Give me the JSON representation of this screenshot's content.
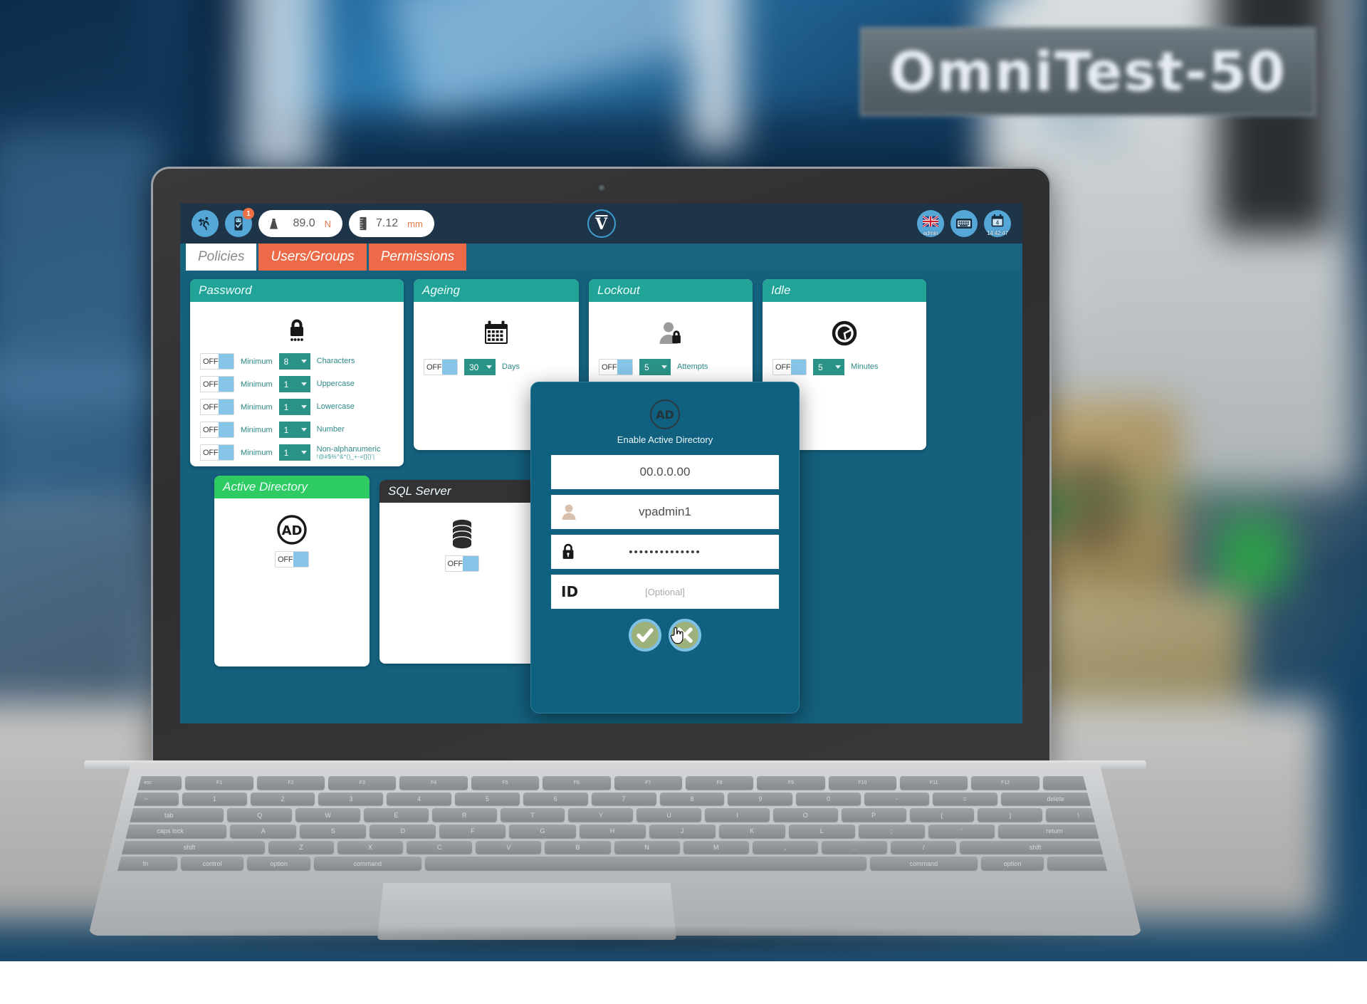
{
  "background": {
    "sign_text": "OmniTest-50"
  },
  "statusbar": {
    "left_buttons": [
      {
        "name": "emergency-stop-icon",
        "label": ""
      },
      {
        "name": "usb-device-icon",
        "label": "",
        "badge": "1"
      }
    ],
    "readouts": [
      {
        "icon": "weight-icon",
        "value": "89.0",
        "unit": "N"
      },
      {
        "icon": "ruler-icon",
        "value": "7.12",
        "unit": "mm"
      }
    ],
    "logo": {
      "name": "vector-v-logo",
      "glyph": "V"
    },
    "right_buttons": [
      {
        "name": "language-user-icon",
        "label": "admin"
      },
      {
        "name": "keyboard-icon",
        "label": ""
      },
      {
        "name": "calendar-clock-icon",
        "label": "14:42:47",
        "day": "4"
      }
    ]
  },
  "tabs": [
    {
      "label": "Policies",
      "active": true
    },
    {
      "label": "Users/Groups",
      "active": false
    },
    {
      "label": "Permissions",
      "active": false
    }
  ],
  "cards": {
    "password": {
      "title": "Password",
      "icon": "password-lock-icon",
      "rows": [
        {
          "toggle": "OFF",
          "prefix": "Minimum",
          "value": "8",
          "unit": "Characters",
          "sub": ""
        },
        {
          "toggle": "OFF",
          "prefix": "Minimum",
          "value": "1",
          "unit": "Uppercase",
          "sub": ""
        },
        {
          "toggle": "OFF",
          "prefix": "Minimum",
          "value": "1",
          "unit": "Lowercase",
          "sub": ""
        },
        {
          "toggle": "OFF",
          "prefix": "Minimum",
          "value": "1",
          "unit": "Number",
          "sub": ""
        },
        {
          "toggle": "OFF",
          "prefix": "Minimum",
          "value": "1",
          "unit": "Non-alphanumeric",
          "sub": "!@#$%^&*()_+-=[]{}'|"
        }
      ]
    },
    "ageing": {
      "title": "Ageing",
      "icon": "calendar-icon",
      "toggle": "OFF",
      "value": "30",
      "unit": "Days"
    },
    "lockout": {
      "title": "Lockout",
      "icon": "user-lock-icon",
      "toggle": "OFF",
      "value": "5",
      "unit": "Attempts"
    },
    "idle": {
      "title": "Idle",
      "icon": "clock-icon",
      "toggle": "OFF",
      "value": "5",
      "unit": "Minutes"
    },
    "active_directory": {
      "title": "Active Directory",
      "icon": "ad-icon",
      "toggle": "OFF"
    },
    "sql_server": {
      "title": "SQL Server",
      "icon": "database-icon",
      "toggle": "OFF"
    }
  },
  "modal": {
    "icon": "ad-icon",
    "title": "Enable Active Directory",
    "fields": [
      {
        "name": "server-address-field",
        "icon": "",
        "value": "00.0.0.00",
        "placeholder": "",
        "is_placeholder": false
      },
      {
        "name": "username-field",
        "icon": "user-icon",
        "value": "vpadmin1",
        "placeholder": "",
        "is_placeholder": false
      },
      {
        "name": "password-field",
        "icon": "lock-icon",
        "value": "••••••••••••••",
        "placeholder": "",
        "is_placeholder": false
      },
      {
        "name": "id-field",
        "icon": "id-glyph",
        "value": "[Optional]",
        "placeholder": "[Optional]",
        "is_placeholder": true
      }
    ],
    "actions": [
      {
        "name": "confirm-button",
        "icon": "check-icon"
      },
      {
        "name": "cancel-button",
        "icon": "close-icon"
      }
    ]
  },
  "colors": {
    "screen_bg": "#14607d",
    "statusbar_bg": "#1e3448",
    "tab_inactive": "#ec6a48",
    "card_header_teal": "#21a397",
    "card_header_green": "#2ecb62",
    "card_header_dark": "#333335",
    "select_bg": "#2a9287",
    "toggle_knob": "#86c5e8",
    "accent_orange": "#e07a4a",
    "modal_bg": "#10607f"
  }
}
